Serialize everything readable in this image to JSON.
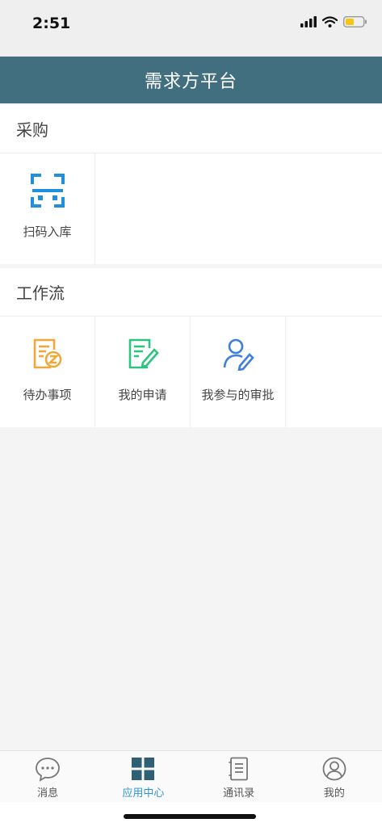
{
  "status_bar": {
    "time": "2:51"
  },
  "header": {
    "title": "需求方平台"
  },
  "sections": [
    {
      "title": "采购",
      "items": [
        {
          "label": "扫码入库",
          "icon": "scan-icon"
        }
      ]
    },
    {
      "title": "工作流",
      "items": [
        {
          "label": "待办事项",
          "icon": "todo-icon"
        },
        {
          "label": "我的申请",
          "icon": "edit-document-icon"
        },
        {
          "label": "我参与的审批",
          "icon": "user-edit-icon"
        }
      ]
    }
  ],
  "tab_bar": {
    "tabs": [
      {
        "label": "消息",
        "icon": "chat-bubble-icon"
      },
      {
        "label": "应用中心",
        "icon": "grid-icon",
        "active": true
      },
      {
        "label": "通讯录",
        "icon": "contacts-book-icon"
      },
      {
        "label": "我的",
        "icon": "user-circle-icon"
      }
    ]
  },
  "colors": {
    "nav_bar": "#426f7f",
    "tab_active": "#2f95d6",
    "scan_icon": "#1f8fe0",
    "todo_icon": "#f2a73b",
    "apply_icon": "#2cc580",
    "approval_icon": "#3d7fe0"
  }
}
